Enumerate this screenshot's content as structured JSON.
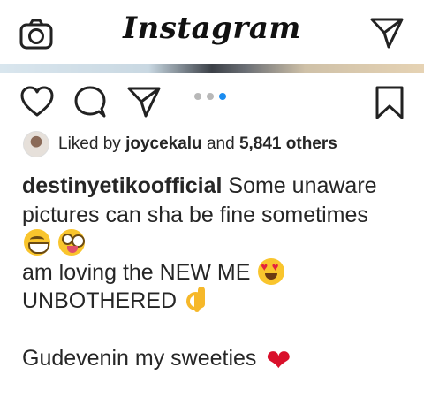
{
  "header": {
    "logo": "Instagram",
    "camera_icon": "camera-icon",
    "direct_icon": "paper-plane-icon"
  },
  "actions": {
    "like_icon": "heart-outline-icon",
    "comment_icon": "comment-bubble-icon",
    "share_icon": "paper-plane-icon",
    "save_icon": "bookmark-icon",
    "carousel_dots": 3,
    "carousel_active": 3
  },
  "likes": {
    "prefix": "Liked by",
    "user": "joycekalu",
    "joiner": "and",
    "others": "5,841 others"
  },
  "caption": {
    "username": "destinyetikoofficial",
    "line1_text": "Some unaware",
    "line2": "pictures can sha be fine sometimes",
    "line4": "am loving the NEW ME",
    "line5": "UNBOTHERED",
    "line7": "Gudevenin my sweeties",
    "emojis": [
      "grinning-face",
      "zany-face",
      "heart-eyes-face",
      "ok-hand",
      "red-heart"
    ]
  },
  "colors": {
    "accent_dot": "#1a8cf0",
    "heart_emoji": "#d9102b",
    "text": "#262626"
  }
}
